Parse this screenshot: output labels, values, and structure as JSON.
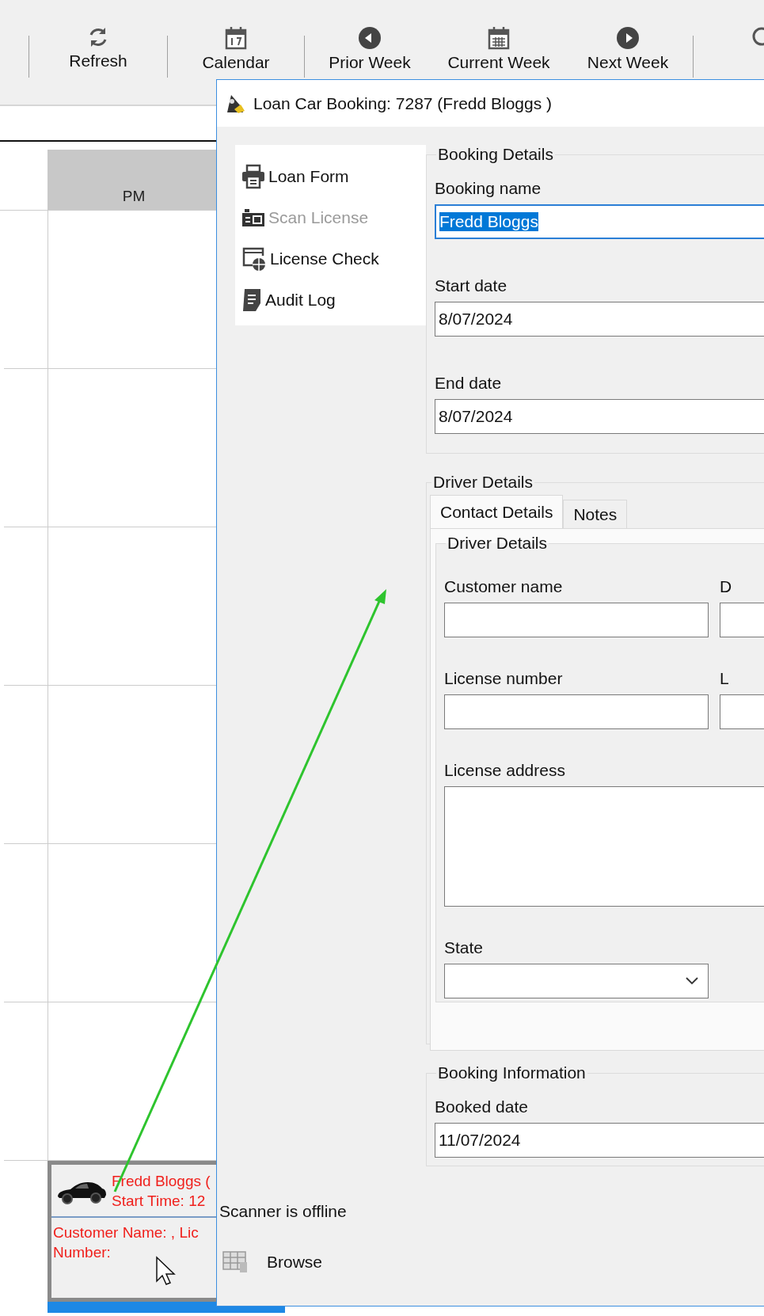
{
  "toolbar": {
    "buttons": [
      {
        "kind": "refresh",
        "label": "Refresh",
        "separator_before": true
      },
      {
        "kind": "calendar",
        "label": "Calendar",
        "separator_before": true
      },
      {
        "kind": "prior",
        "label": "Prior Week",
        "separator_before": true
      },
      {
        "kind": "week",
        "label": "Current Week",
        "separator_before": false
      },
      {
        "kind": "next",
        "label": "Next Week",
        "separator_before": false
      },
      {
        "kind": "search",
        "separator_before": true
      }
    ]
  },
  "calendar": {
    "column_header": "PM",
    "appointment": {
      "title_lines": [
        "Fredd Bloggs (",
        "Start Time: 12"
      ],
      "body_lines": [
        "Customer Name: , Lic",
        "Number:"
      ]
    }
  },
  "dialog": {
    "title": "Loan Car Booking: 7287 (Fredd Bloggs )",
    "menu": [
      {
        "kind": "printer",
        "label": "Loan Form",
        "disabled": false
      },
      {
        "kind": "scanner",
        "label": "Scan License",
        "disabled": true
      },
      {
        "kind": "globe",
        "label": "License Check",
        "disabled": false
      },
      {
        "kind": "document",
        "label": "Audit Log",
        "disabled": false
      }
    ],
    "status": "Scanner is offline",
    "browse": {
      "label": "Browse"
    },
    "booking_details": {
      "title": "Booking Details",
      "fields": [
        {
          "kind": "text",
          "label": "Booking name",
          "value": "Fredd Bloggs",
          "focused": true
        },
        {
          "kind": "text",
          "label": "Start date",
          "value": "8/07/2024",
          "focused": false
        },
        {
          "kind": "text",
          "label": "End date",
          "value": "8/07/2024",
          "focused": false
        }
      ]
    },
    "driver_details": {
      "title": "Driver Details",
      "tabs": [
        {
          "label": "Contact Details",
          "selected": true
        },
        {
          "label": "Notes",
          "selected": false
        }
      ],
      "inner_title": "Driver Details",
      "fields": [
        {
          "kind": "text",
          "label": "Customer name",
          "side_label": "D"
        },
        {
          "kind": "text",
          "label": "License number",
          "side_label": "L"
        },
        {
          "kind": "textarea",
          "label": "License address"
        },
        {
          "kind": "dropdown",
          "label": "State"
        }
      ]
    },
    "booking_information": {
      "title": "Booking Information",
      "fields": [
        {
          "kind": "text",
          "label": "Booked date",
          "value": "11/07/2024",
          "focused": false
        }
      ]
    }
  }
}
